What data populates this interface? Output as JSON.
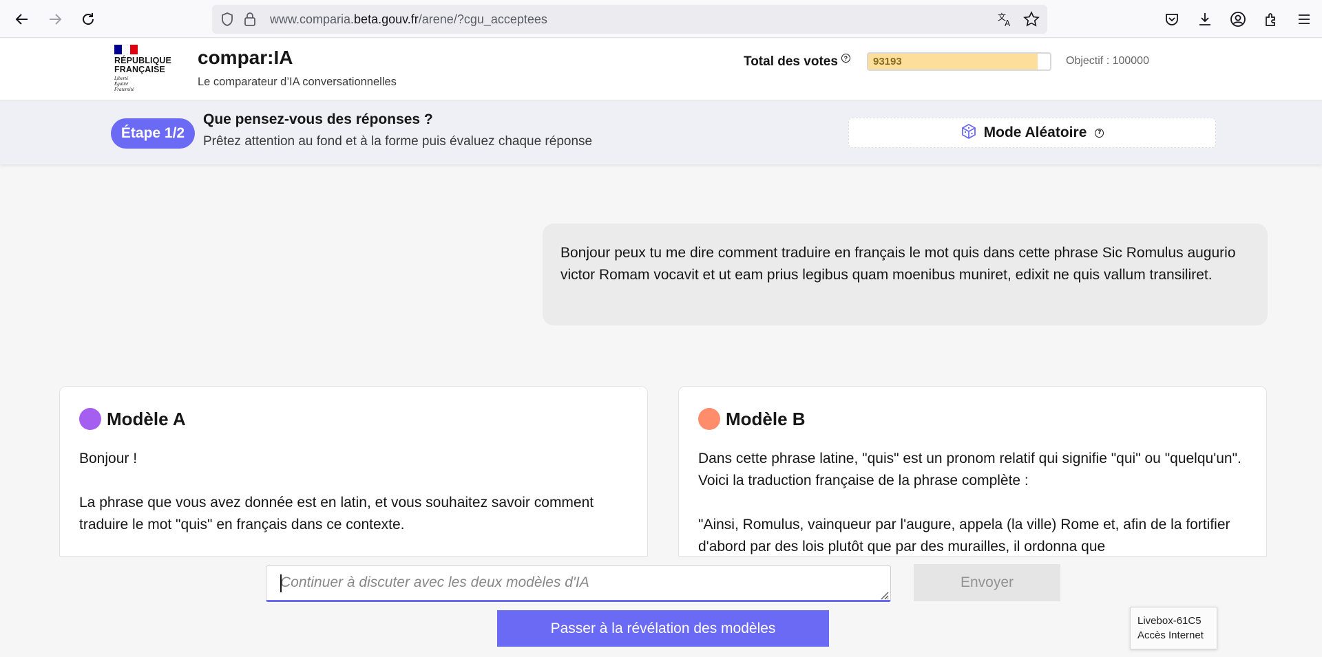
{
  "browser": {
    "url_prefix": "www.comparia.",
    "url_domain": "beta.gouv.fr",
    "url_path": "/arene/?cgu_acceptees"
  },
  "header": {
    "rf_title_1": "RÉPUBLIQUE",
    "rf_title_2": "FRANÇAISE",
    "rf_motto_1": "Liberté",
    "rf_motto_2": "Égalité",
    "rf_motto_3": "Fraternité",
    "site_title": "compar:IA",
    "site_subtitle": "Le comparateur d’IA conversationnelles",
    "votes_label": "Total des votes",
    "votes_value": "93193",
    "votes_progress": 0.93193,
    "objective_label": "Objectif : 100000"
  },
  "step": {
    "pill": "Étape 1/2",
    "title": "Que pensez-vous des réponses ?",
    "subtitle": "Prêtez attention au fond et à la forme puis évaluez chaque réponse",
    "mode_label": "Mode Aléatoire"
  },
  "conversation": {
    "user_message": "Bonjour peux tu me dire comment traduire en français le mot quis dans cette phrase Sic Romulus augurio victor Romam vocavit et ut eam prius legibus quam moenibus muniret, edixit ne quis vallum transiliret."
  },
  "models": [
    {
      "name": "Modèle A",
      "color": "#a55ff0",
      "paragraphs": [
        "Bonjour !",
        "La phrase que vous avez donnée est en latin, et vous souhaitez savoir comment traduire le mot \"quis\" en français dans ce contexte."
      ]
    },
    {
      "name": "Modèle B",
      "color": "#ff8d6b",
      "paragraphs": [
        "Dans cette phrase latine, \"quis\" est un pronom relatif qui signifie \"qui\" ou \"quelqu'un\". Voici la traduction française de la phrase complète :",
        "\"Ainsi, Romulus, vainqueur par l'augure, appela (la ville) Rome et, afin de la fortifier d'abord par des lois plutôt que par des murailles, il ordonna que"
      ]
    }
  ],
  "composer": {
    "placeholder": "Continuer à discuter avec les deux modèles d'IA",
    "send_label": "Envoyer",
    "reveal_label": "Passer à la révélation des modèles"
  },
  "tooltip": {
    "line1": "Livebox-61C5",
    "line2": "Accès Internet"
  },
  "colors": {
    "accent": "#6a6af4",
    "progress_fill": "#fddf9b"
  }
}
